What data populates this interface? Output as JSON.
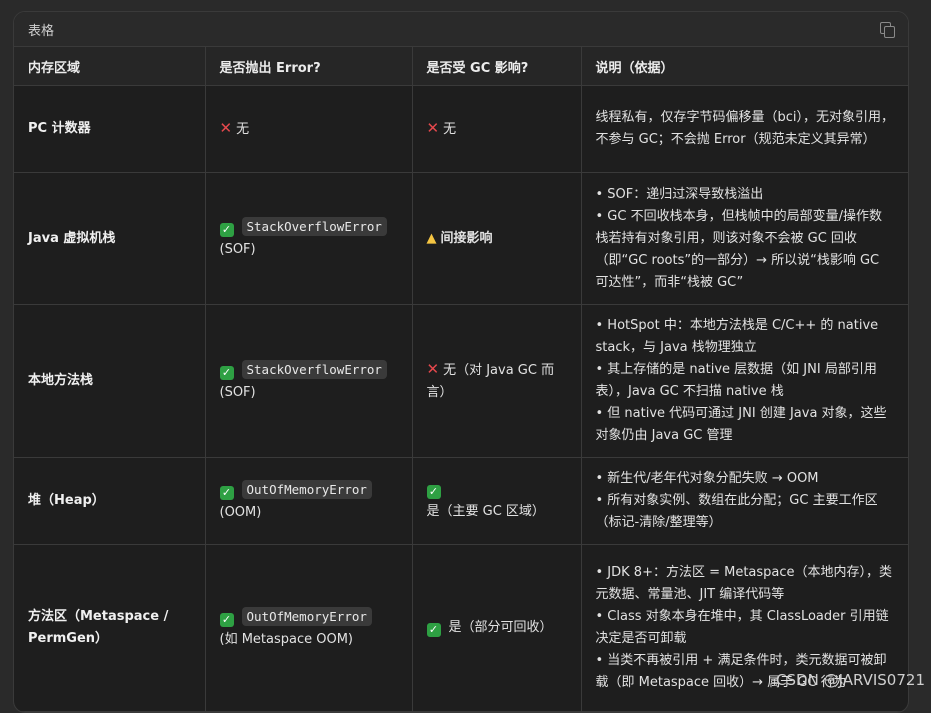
{
  "panel": {
    "title": "表格"
  },
  "headers": [
    "内存区域",
    "是否抛出 Error?",
    "是否受 GC 影响?",
    "说明（依据）"
  ],
  "rows": [
    {
      "area": "PC 计数器",
      "error": {
        "icon": "x-icon",
        "text": "无"
      },
      "gc": {
        "icon": "x-icon",
        "text": "无"
      },
      "desc": [
        "线程私有，仅存字节码偏移量（bci），无对象引用，不参与 GC；不会抛 Error（规范未定义其异常）"
      ]
    },
    {
      "area": "Java 虚拟机栈",
      "error": {
        "icon": "check-icon",
        "code": "StackOverflowError",
        "text": "(SOF)"
      },
      "gc": {
        "icon": "warning-icon",
        "text": "间接影响"
      },
      "desc": [
        "• SOF：递归过深导致栈溢出",
        "• GC 不回收栈本身，但栈帧中的局部变量/操作数栈若持有对象引用，则该对象不会被 GC 回收（即“GC roots”的一部分）→ 所以说“栈影响 GC 可达性”，而非“栈被 GC”"
      ]
    },
    {
      "area": "本地方法栈",
      "error": {
        "icon": "check-icon",
        "code": "StackOverflowError",
        "text": "(SOF)"
      },
      "gc": {
        "icon": "x-icon",
        "text": "无（对 Java GC 而言）"
      },
      "desc": [
        "• HotSpot 中：本地方法栈是 C/C++ 的 native stack，与 Java 栈物理独立",
        "• 其上存储的是 native 层数据（如 JNI 局部引用表），Java GC 不扫描 native 栈",
        "• 但 native 代码可通过 JNI 创建 Java 对象，这些对象仍由 Java GC 管理"
      ]
    },
    {
      "area": "堆（Heap）",
      "error": {
        "icon": "check-icon",
        "code": "OutOfMemoryError",
        "text": "(OOM)"
      },
      "gc": {
        "icon": "check-icon",
        "text": "是（主要 GC 区域）"
      },
      "desc": [
        "• 新生代/老年代对象分配失败 → OOM",
        "• 所有对象实例、数组在此分配；GC 主要工作区（标记-清除/整理等）"
      ]
    },
    {
      "area": "方法区（Metaspace / PermGen）",
      "error": {
        "icon": "check-icon",
        "code": "OutOfMemoryError",
        "text": "(如 Metaspace OOM)"
      },
      "gc": {
        "icon": "check-icon",
        "text": "是（部分可回收）"
      },
      "desc": [
        "• JDK 8+：方法区 = Metaspace（本地内存），类元数据、常量池、JIT 编译代码等",
        "• Class 对象本身在堆中，其 ClassLoader 引用链决定是否可卸载",
        "• 当类不再被引用 + 满足条件时，类元数据可被卸载（即 Metaspace 回收）→ 属于 GC 行为"
      ]
    }
  ],
  "watermark": "CSDN @JARVIS0721"
}
